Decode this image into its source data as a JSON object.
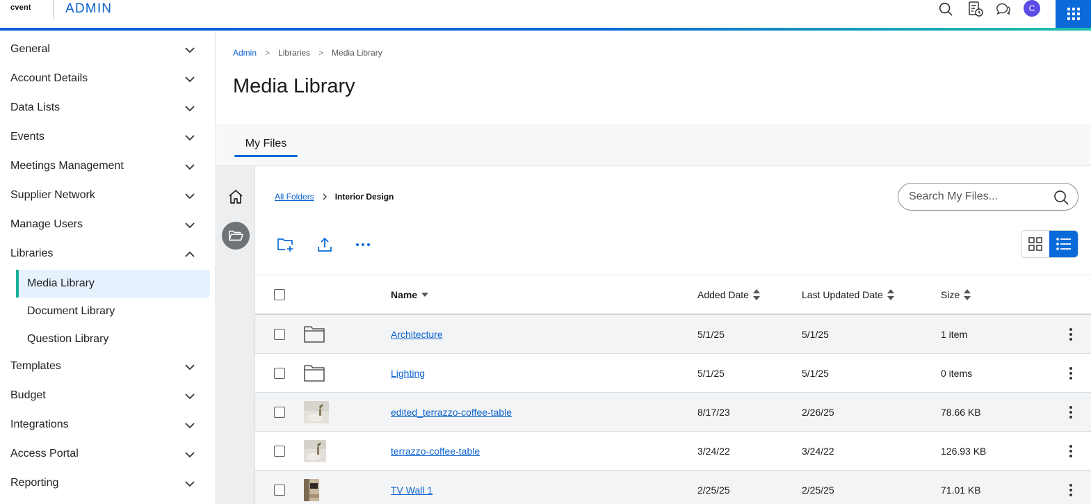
{
  "header": {
    "logo_text": "cvent",
    "app_title": "ADMIN",
    "avatar_initial": "C",
    "icons": [
      "search-icon",
      "event-schedule-icon",
      "chat-icon",
      "avatar",
      "app-grid-icon"
    ]
  },
  "sidebar": {
    "items": [
      {
        "label": "General",
        "expanded": false
      },
      {
        "label": "Account Details",
        "expanded": false
      },
      {
        "label": "Data Lists",
        "expanded": false
      },
      {
        "label": "Events",
        "expanded": false
      },
      {
        "label": "Meetings Management",
        "expanded": false
      },
      {
        "label": "Supplier Network",
        "expanded": false
      },
      {
        "label": "Manage Users",
        "expanded": false
      },
      {
        "label": "Libraries",
        "expanded": true
      },
      {
        "label": "Templates",
        "expanded": false
      },
      {
        "label": "Budget",
        "expanded": false
      },
      {
        "label": "Integrations",
        "expanded": false
      },
      {
        "label": "Access Portal",
        "expanded": false
      },
      {
        "label": "Reporting",
        "expanded": false
      }
    ],
    "libraries_children": [
      {
        "label": "Media Library",
        "active": true
      },
      {
        "label": "Document Library",
        "active": false
      },
      {
        "label": "Question Library",
        "active": false
      }
    ]
  },
  "breadcrumb": {
    "items": [
      "Admin",
      "Libraries",
      "Media Library"
    ]
  },
  "page": {
    "title": "Media Library"
  },
  "tabs": [
    {
      "label": "My Files",
      "active": true
    }
  ],
  "folder_breadcrumb": {
    "root": "All Folders",
    "current": "Interior Design"
  },
  "search": {
    "placeholder": "Search My Files..."
  },
  "toolbar": {
    "icons": [
      "new-folder-icon",
      "upload-icon",
      "more-horizontal-icon"
    ]
  },
  "view_toggle": {
    "options": [
      "grid",
      "list"
    ],
    "selected": "list"
  },
  "table": {
    "columns": {
      "name": "Name",
      "added": "Added Date",
      "updated": "Last Updated Date",
      "size": "Size"
    },
    "rows": [
      {
        "type": "folder",
        "name": "Architecture",
        "added": "5/1/25",
        "updated": "5/1/25",
        "size": "1 item"
      },
      {
        "type": "folder",
        "name": "Lighting",
        "added": "5/1/25",
        "updated": "5/1/25",
        "size": "0 items"
      },
      {
        "type": "image",
        "name": "edited_terrazzo-coffee-table",
        "added": "8/17/23",
        "updated": "2/26/25",
        "size": "78.66 KB"
      },
      {
        "type": "image",
        "name": "terrazzo-coffee-table",
        "added": "3/24/22",
        "updated": "3/24/22",
        "size": "126.93 KB"
      },
      {
        "type": "image",
        "name": "TV Wall 1",
        "added": "2/25/25",
        "updated": "2/25/25",
        "size": "71.01 KB"
      }
    ]
  },
  "colors": {
    "brand_blue": "#0b6ad9",
    "link_blue": "#0b63ce",
    "active_bar": "#1bb09a",
    "active_bg": "#e5f1fd",
    "avatar_bg": "#5a4de6"
  }
}
